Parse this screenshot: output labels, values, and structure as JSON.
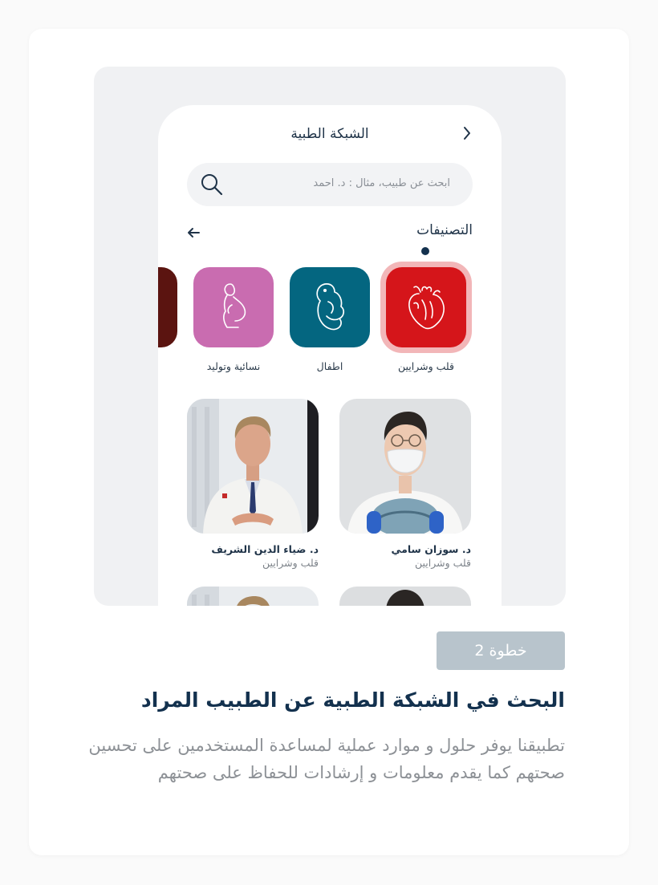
{
  "phone": {
    "title": "الشبكة الطبية",
    "search_placeholder": "ابحث عن طبيب، مثال : د. احمد",
    "categories_heading": "التصنيفات",
    "categories": [
      {
        "label": "قلب وشرايين",
        "icon": "heart-icon",
        "color": "#d5151a",
        "selected": true
      },
      {
        "label": "اطفال",
        "icon": "baby-icon",
        "color": "#046680",
        "selected": false
      },
      {
        "label": "نسائية وتوليد",
        "icon": "pregnant-woman-icon",
        "color": "#c96cb0",
        "selected": false
      },
      {
        "label": "",
        "icon": "partial-category-icon",
        "color": "#5b1410",
        "selected": false
      }
    ],
    "doctors": [
      {
        "name": "د. سوزان سامي",
        "specialty": "قلب وشرايين"
      },
      {
        "name": "د. ضياء الدين الشريف",
        "specialty": "قلب وشرايين"
      }
    ]
  },
  "step": {
    "label": "خطوة 2"
  },
  "headline": "البحث في الشبكة الطبية عن الطبيب المراد",
  "description": "تطبيقنا يوفر حلول و موارد عملية لمساعدة المستخدمين على تحسين صحتهم كما يقدم معلومات و إرشادات للحفاظ على صحتهم",
  "colors": {
    "primary_dark": "#13314e",
    "badge_bg": "#b8c4cc",
    "selected_ring": "#f2b6b8"
  }
}
